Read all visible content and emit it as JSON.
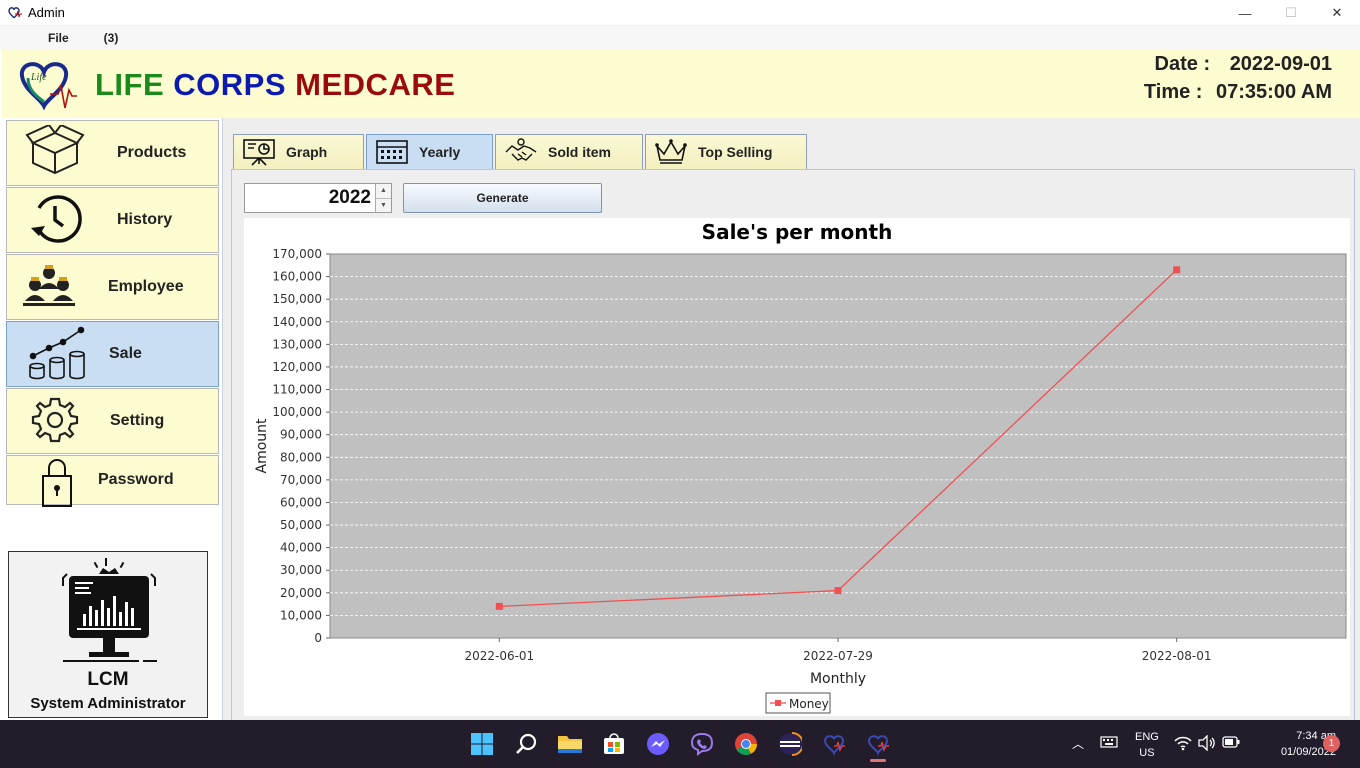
{
  "window": {
    "title": "Admin",
    "minimize": "—",
    "maximize": "☐",
    "close": "✕"
  },
  "menu": {
    "file": "File",
    "count": "(3)"
  },
  "header": {
    "brand_1": "LIFE",
    "brand_2": "CORPS",
    "brand_3": "MEDCARE",
    "date_label": "Date :",
    "date_value": "2022-09-01",
    "time_label": "Time :",
    "time_value": "07:35:00 AM"
  },
  "sidebar": {
    "items": [
      {
        "label": "Products",
        "icon": "box-icon"
      },
      {
        "label": "History",
        "icon": "history-icon"
      },
      {
        "label": "Employee",
        "icon": "employees-icon"
      },
      {
        "label": "Sale",
        "icon": "sales-chart-icon"
      },
      {
        "label": "Setting",
        "icon": "gear-icon"
      },
      {
        "label": "Password",
        "icon": "lock-icon"
      }
    ],
    "active_index": 3,
    "admin": {
      "code": "LCM",
      "role": "System Administrator"
    }
  },
  "tabs": [
    {
      "label": "Graph",
      "icon": "presentation-icon"
    },
    {
      "label": "Yearly",
      "icon": "calendar-icon"
    },
    {
      "label": "Sold item",
      "icon": "handshake-icon"
    },
    {
      "label": "Top Selling",
      "icon": "crown-icon"
    }
  ],
  "controls": {
    "year": "2022",
    "generate_label": "Generate"
  },
  "colors": {
    "series": "#f05050",
    "plot_bg": "#c0c0c0",
    "active": "#c9ddf3",
    "header_bg": "#fdfcd0"
  },
  "chart_data": {
    "type": "line",
    "title": "Sale's per month",
    "xlabel": "Monthly",
    "ylabel": "Amount",
    "categories": [
      "2022-06-01",
      "2022-07-29",
      "2022-08-01"
    ],
    "series": [
      {
        "name": "Money",
        "values": [
          14000,
          21000,
          163000
        ]
      }
    ],
    "ylim": [
      0,
      170000
    ],
    "yticks": [
      "0",
      "10,000",
      "20,000",
      "30,000",
      "40,000",
      "50,000",
      "60,000",
      "70,000",
      "80,000",
      "90,000",
      "100,000",
      "110,000",
      "120,000",
      "130,000",
      "140,000",
      "150,000",
      "160,000",
      "170,000"
    ],
    "grid": true,
    "legend": "bottom"
  },
  "taskbar": {
    "lang_1": "ENG",
    "lang_2": "US",
    "time": "7:34 am",
    "date": "01/09/2022",
    "notifications": "1"
  }
}
